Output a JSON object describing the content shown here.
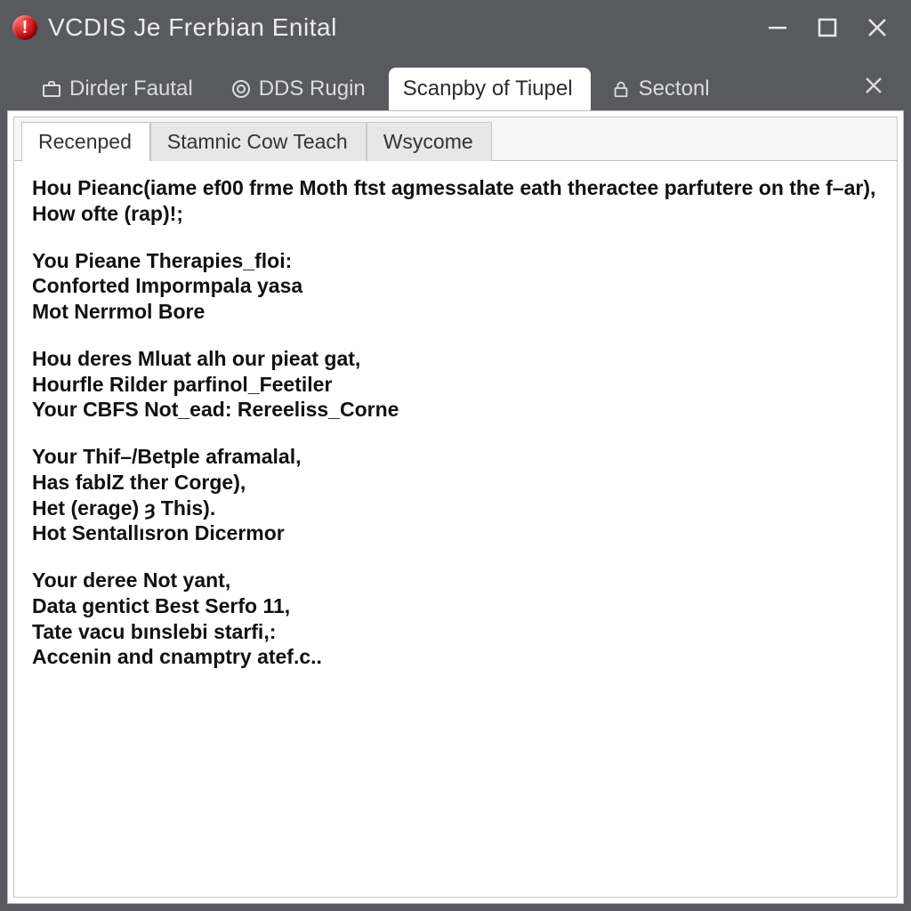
{
  "window": {
    "title": "VCDIS Je Frerbian Enital"
  },
  "outer_tabs": [
    {
      "label": "Dirder Fautal",
      "icon": "briefcase"
    },
    {
      "label": "DDS Rugin",
      "icon": "target"
    },
    {
      "label": "Scanpby of Tiupel",
      "icon": "",
      "active": true
    },
    {
      "label": "Sectonl",
      "icon": "lock"
    }
  ],
  "inner_tabs": [
    {
      "label": "Recenped",
      "active": true
    },
    {
      "label": "Stamnic Cow Teach"
    },
    {
      "label": "Wsycome"
    }
  ],
  "content_blocks": [
    "Hou Pieanc(iame ef00 frme Moth ftst agmessalate eath theractee parfutere on the f–ar),\nHow ofte (rap)!;",
    "You Pieane Therapies_floi:\nConforted Impormpala yasa\nMot Nerrmol Bore",
    "Hou deres Mluat alh our pieat gat,\nHourfle Rilder parfinol_Feetiler\nYour CBFS Not_ead: Rereeliss_Corne",
    "Your Thif–/Betple aframalal,\nHas fablZ ther Corge),\nHet (erage) ȝ This).\nHot Sentallısron Dicermor",
    "Your deree Not yant,\nData gentict Best Serfo 11,\nTate vacu bınslebi starfi,:\nAccenin and cnamptry atef.c.."
  ]
}
